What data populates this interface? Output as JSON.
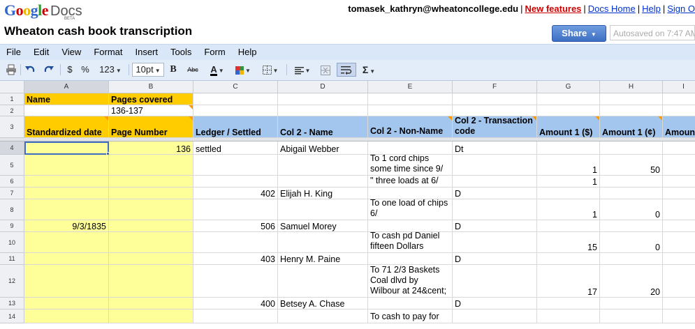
{
  "app": {
    "logo_google": "Google",
    "logo_docs": "Docs",
    "logo_beta": "BETA"
  },
  "header": {
    "user_email": "tomasek_kathryn@wheatoncollege.edu",
    "links": [
      "New features",
      "Docs Home",
      "Help",
      "Sign O"
    ],
    "doc_title": "Wheaton cash book transcription",
    "share_label": "Share",
    "autosave_text": "Autosaved on 7:47 AM"
  },
  "menu": [
    "File",
    "Edit",
    "View",
    "Format",
    "Insert",
    "Tools",
    "Form",
    "Help"
  ],
  "toolbar": {
    "currency": "$",
    "percent": "%",
    "number_format": "123",
    "font_size": "10pt",
    "bold": "B",
    "strike": "Abc",
    "text_color": "A",
    "sum": "Σ"
  },
  "columns": [
    "A",
    "B",
    "C",
    "D",
    "E",
    "F",
    "G",
    "H",
    "I"
  ],
  "rows": [
    {
      "num": "1",
      "cells": [
        "Name",
        "Pages covered",
        "",
        "",
        "",
        "",
        "",
        "",
        ""
      ]
    },
    {
      "num": "2",
      "cells": [
        "",
        "136-137",
        "",
        "",
        "",
        "",
        "",
        "",
        ""
      ]
    },
    {
      "num": "3",
      "cells": [
        "Standardized date",
        "Page Number",
        "Ledger / Settled",
        "Col 2 - Name",
        "Col 2 - Non-Name",
        "Col 2 - Transaction code",
        "Amount 1 ($)",
        "Amount 1 (¢)",
        "Amount"
      ]
    },
    {
      "num": "4",
      "cells": [
        "",
        "136",
        "settled",
        "Abigail Webber",
        "",
        "Dt",
        "",
        "",
        ""
      ]
    },
    {
      "num": "5",
      "cells": [
        "",
        "",
        "",
        "",
        "To 1 cord chips some time since 9/",
        "",
        "1",
        "50",
        ""
      ]
    },
    {
      "num": "6",
      "cells": [
        "",
        "",
        "",
        "",
        "\" three loads at 6/",
        "",
        "1",
        "",
        ""
      ]
    },
    {
      "num": "7",
      "cells": [
        "",
        "",
        "402",
        "Elijah H. King",
        "",
        "D",
        "",
        "",
        ""
      ]
    },
    {
      "num": "8",
      "cells": [
        "",
        "",
        "",
        "",
        "To one load of chips 6/",
        "",
        "1",
        "0",
        ""
      ]
    },
    {
      "num": "9",
      "cells": [
        "9/3/1835",
        "",
        "506",
        "Samuel Morey",
        "",
        "D",
        "",
        "",
        ""
      ]
    },
    {
      "num": "10",
      "cells": [
        "",
        "",
        "",
        "",
        "To cash pd Daniel fifteen Dollars",
        "",
        "15",
        "0",
        ""
      ]
    },
    {
      "num": "11",
      "cells": [
        "",
        "",
        "403",
        "Henry M. Paine",
        "",
        "D",
        "",
        "",
        ""
      ]
    },
    {
      "num": "12",
      "cells": [
        "",
        "",
        "",
        "",
        "To 71 2/3 Baskets Coal dlvd by Wilbour at 24&cent;",
        "",
        "17",
        "20",
        ""
      ]
    },
    {
      "num": "13",
      "cells": [
        "",
        "",
        "400",
        "Betsey A. Chase",
        "",
        "D",
        "",
        "",
        ""
      ]
    },
    {
      "num": "14",
      "cells": [
        "",
        "",
        "",
        "",
        "To cash to pay for",
        "",
        "",
        "",
        ""
      ]
    }
  ],
  "colors": {
    "header_orange": "#ffcc00",
    "header_blue": "#a3c6ef",
    "highlight_yellow": "#ffff99",
    "menubar": "#d9e7f8",
    "share_blue": "#3d6ec2"
  }
}
